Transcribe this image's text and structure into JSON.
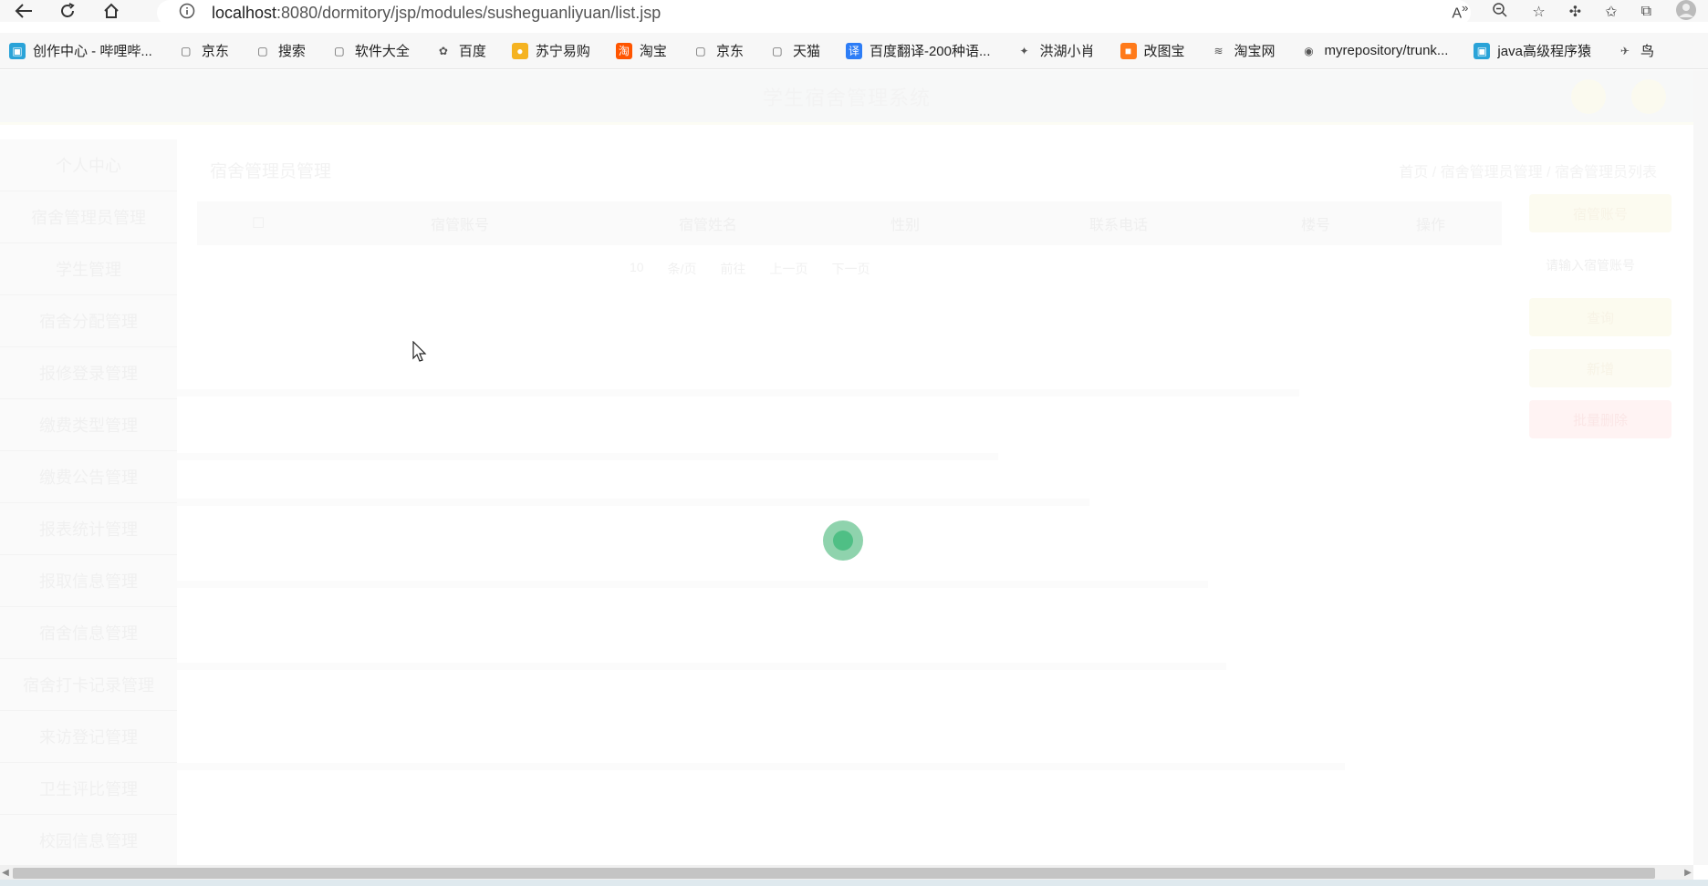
{
  "browser": {
    "url_host": "localhost",
    "url_rest": ":8080/dormitory/jsp/modules/susheguanliyuan/list.jsp",
    "bookmarks": [
      {
        "label": "创作中心 - 哔哩哔...",
        "icon": "bilibili-icon"
      },
      {
        "label": "京东",
        "icon": "page-icon"
      },
      {
        "label": "搜索",
        "icon": "page-icon"
      },
      {
        "label": "软件大全",
        "icon": "page-icon"
      },
      {
        "label": "百度",
        "icon": "baidu-icon"
      },
      {
        "label": "苏宁易购",
        "icon": "suning-icon"
      },
      {
        "label": "淘宝",
        "icon": "taobao-icon"
      },
      {
        "label": "京东",
        "icon": "page-icon"
      },
      {
        "label": "天猫",
        "icon": "page-icon"
      },
      {
        "label": "百度翻译-200种语...",
        "icon": "translate-icon"
      },
      {
        "label": "洪湖小肖",
        "icon": "bird-icon"
      },
      {
        "label": "改图宝",
        "icon": "gaitubao-icon"
      },
      {
        "label": "淘宝网",
        "icon": "taobao-net-icon"
      },
      {
        "label": "myrepository/trunk...",
        "icon": "chrome-icon"
      },
      {
        "label": "java高级程序猿",
        "icon": "bilibili-icon"
      },
      {
        "label": "鸟",
        "icon": "bird-red-icon"
      }
    ]
  },
  "app": {
    "title": "学生宿舍管理系统",
    "sidebar": [
      "个人中心",
      "宿舍管理员管理",
      "学生管理",
      "宿舍分配管理",
      "报修登录管理",
      "缴费类型管理",
      "缴费公告管理",
      "报表统计管理",
      "报取信息管理",
      "宿舍信息管理",
      "宿舍打卡记录管理",
      "来访登记管理",
      "卫生评比管理",
      "校园信息管理"
    ],
    "page_title": "宿舍管理员管理",
    "breadcrumb": "首页 / 宿舍管理员管理 / 宿舍管理员列表",
    "table_headers": [
      "宿管账号",
      "宿管姓名",
      "性别",
      "联系电话",
      "楼号",
      "操作"
    ],
    "pager": [
      "10",
      "条/页",
      "前往",
      "上一页",
      "下一页"
    ],
    "right_panel": {
      "button_top": "宿管账号",
      "search_placeholder": "请输入宿管账号",
      "query_button": "查询",
      "add_button": "新增",
      "delete_button": "批量删除"
    }
  }
}
